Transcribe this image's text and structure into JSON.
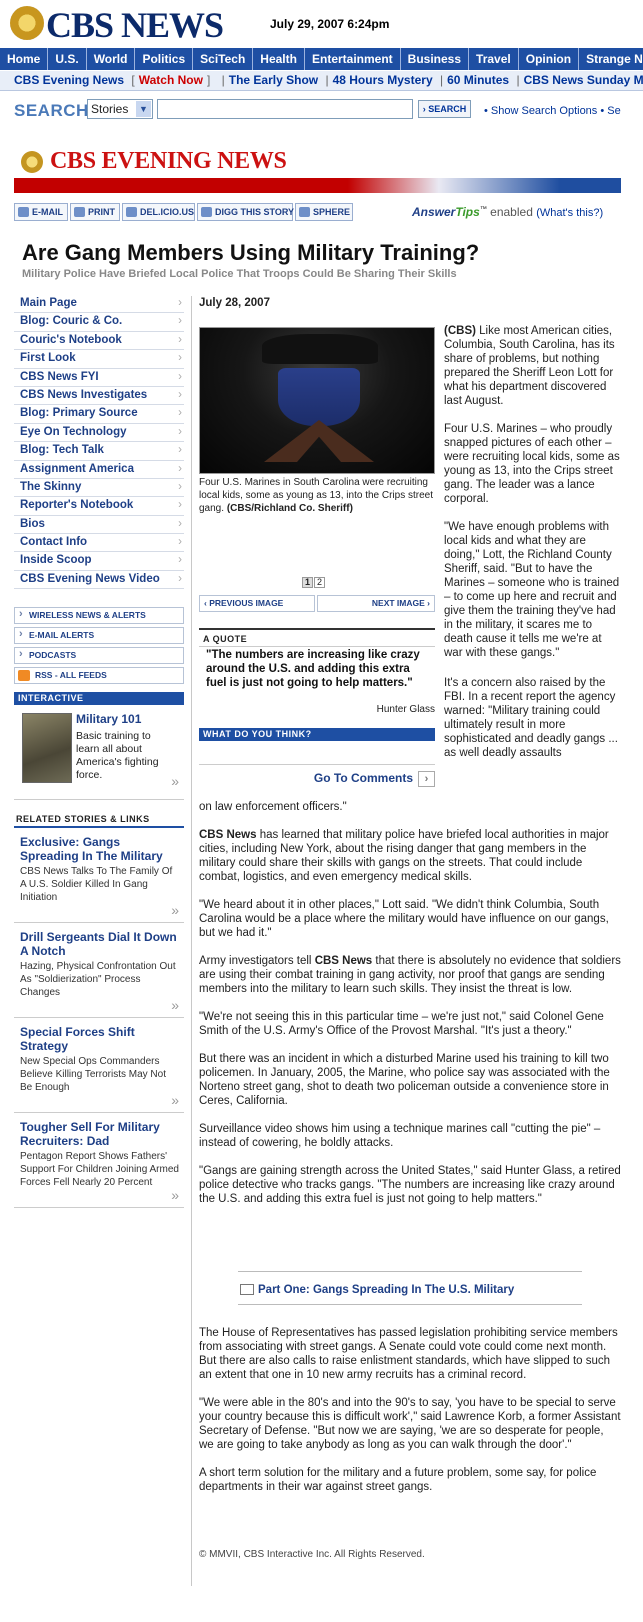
{
  "masthead": {
    "logo_text": "CBS NEWS",
    "dateline": "July 29, 2007 6:24pm"
  },
  "nav": [
    "Home",
    "U.S.",
    "World",
    "Politics",
    "SciTech",
    "Health",
    "Entertainment",
    "Business",
    "Travel",
    "Opinion",
    "Strange N"
  ],
  "subnav": {
    "first": "CBS Evening News",
    "watch_now": "Watch Now",
    "items": [
      "The Early Show",
      "48 Hours Mystery",
      "60 Minutes",
      "CBS News Sunday Morni"
    ]
  },
  "search": {
    "label": "SEARCH",
    "select_value": "Stories",
    "input_value": "",
    "button": "SEARCH",
    "options_link": "• Show Search Options  • Se"
  },
  "section": {
    "title": "CBS EVENING NEWS"
  },
  "tools": {
    "email": "E-MAIL",
    "print": "PRINT",
    "delicious": "DEL.ICIO.US",
    "digg": "DIGG THIS STORY",
    "sphere": "SPHERE",
    "answer": "Answer",
    "tips": "Tips",
    "tm": "™",
    "enabled": "enabled",
    "whats_this": "(What's this?)"
  },
  "article": {
    "headline": "Are Gang Members Using Military Training?",
    "subhead": "Military Police Have Briefed Local Police That Troops Could Be Sharing Their Skills",
    "date": "July 28, 2007",
    "caption_text": "Four U.S. Marines in South Carolina were recruiting local kids, some as young as 13, into the Crips street gang. ",
    "caption_credit": "(CBS/Richland Co. Sheriff)",
    "pages": [
      "1",
      "2"
    ],
    "prev_image": "PREVIOUS IMAGE",
    "next_image": "NEXT IMAGE",
    "quote_head": "A QUOTE",
    "quote_text": "\"The numbers are increasing like crazy around the U.S. and adding this extra fuel is just not going to help matters.\"",
    "quote_by": "Hunter Glass",
    "wdyt": "WHAT DO YOU THINK?",
    "comments": "Go To Comments",
    "p1_source": "(CBS)",
    "p1_text": " Like most American cities, Columbia, South Carolina, has its share of problems, but nothing prepared the Sheriff Leon Lott for what his department discovered last August.",
    "p2": "Four U.S. Marines – who proudly snapped pictures of each other – were recruiting local kids, some as young as 13, into the Crips street gang. The leader was a lance corporal.",
    "p3": "\"We have enough problems with local kids and what they are doing,\" Lott, the Richland County Sheriff, said. \"But to have the Marines – someone who is trained – to come up here and recruit and give them the training they've had in the military, it scares me to death cause it tells me we're at war with these gangs.\"",
    "p4": "It's a concern also raised by the FBI. In a recent report the agency warned: \"Military training could ultimately result in more sophisticated and deadly gangs ... as well deadly assaults",
    "p4_cont": "on law enforcement officers.\"",
    "p5_bold": "CBS News",
    "p5": " has learned that military police have briefed local authorities in major cities, including New York, about the rising danger that gang members in the military could share their skills with gangs on the streets. That could include combat, logistics, and even emergency medical skills.",
    "p6": "\"We heard about it in other places,\" Lott said. \"We didn't think Columbia, South Carolina would be a place where the military would have influence on our gangs, but we had it.\"",
    "p7a": "Army investigators tell ",
    "p7_bold": "CBS News",
    "p7b": " that there is absolutely no evidence that soldiers are using their combat training in gang activity, nor proof that gangs are sending members into the military to learn such skills. They insist the threat is low.",
    "p8": "\"We're not seeing this in this particular time – we're just not,\" said Colonel Gene Smith of the U.S. Army's Office of the Provost Marshal. \"It's just a theory.\"",
    "p9": "But there was an incident in which a disturbed Marine used his training to kill two policemen. In January, 2005, the Marine, who police say was associated with the Norteno street gang, shot to death two policeman outside a convenience store in Ceres, California.",
    "p10": "Surveillance video shows him using a technique marines call \"cutting the pie\" – instead of cowering, he boldly attacks.",
    "p11": "\"Gangs are gaining strength across the United States,\" said Hunter Glass, a retired police detective who tracks gangs. \"The numbers are increasing like crazy around the U.S. and adding this extra fuel is just not going to help matters.\"",
    "part_one": "Part One: Gangs Spreading In The U.S. Military",
    "p12": "The House of Representatives has passed legislation prohibiting service members from associating with street gangs. A Senate could vote could come next month. But there are also calls to raise enlistment standards, which have slipped to such an extent that one in 10 new army recruits has a criminal record.",
    "p13": "\"We were able in the 80's and into the 90's to say, 'you have to be special to serve your country because this is difficult work',\" said Lawrence Korb, a former Assistant Secretary of Defense. \"But now we are saying, 'we are so desperate for people, we are going to take anybody as long as you can walk through the door'.\"",
    "p14": "A short term solution for the military and a future problem, some say, for police departments in their war against street gangs."
  },
  "leftnav": [
    "Main Page",
    "Blog: Couric & Co.",
    "Couric's Notebook",
    "First Look",
    "CBS News FYI",
    "CBS News Investigates",
    "Blog: Primary Source",
    "Eye On Technology",
    "Blog: Tech Talk",
    "Assignment America",
    "The Skinny",
    "Reporter's Notebook",
    "Bios",
    "Contact Info",
    "Inside Scoop",
    "CBS Evening News Video"
  ],
  "alerts": [
    "WIRELESS NEWS & ALERTS",
    "E-MAIL ALERTS",
    "PODCASTS",
    "RSS - ALL FEEDS"
  ],
  "interactive": {
    "head": "INTERACTIVE",
    "title": "Military 101",
    "text": "Basic training to learn all about America's fighting force."
  },
  "related": {
    "head": "RELATED STORIES & LINKS",
    "items": [
      {
        "title": "Exclusive: Gangs Spreading In The Military",
        "text": "CBS News Talks To The Family Of A U.S. Soldier Killed In Gang Initiation"
      },
      {
        "title": "Drill Sergeants Dial It Down A Notch",
        "text": "Hazing, Physical Confrontation Out As \"Soldierization\" Process Changes"
      },
      {
        "title": "Special Forces Shift Strategy",
        "text": "New Special Ops Commanders Believe Killing Terrorists May Not Be Enough"
      },
      {
        "title": "Tougher Sell For Military Recruiters: Dad",
        "text": "Pentagon Report Shows Fathers' Support For Children Joining Armed Forces Fell Nearly 20 Percent"
      }
    ]
  },
  "footer": "© MMVII, CBS Interactive Inc. All Rights Reserved."
}
